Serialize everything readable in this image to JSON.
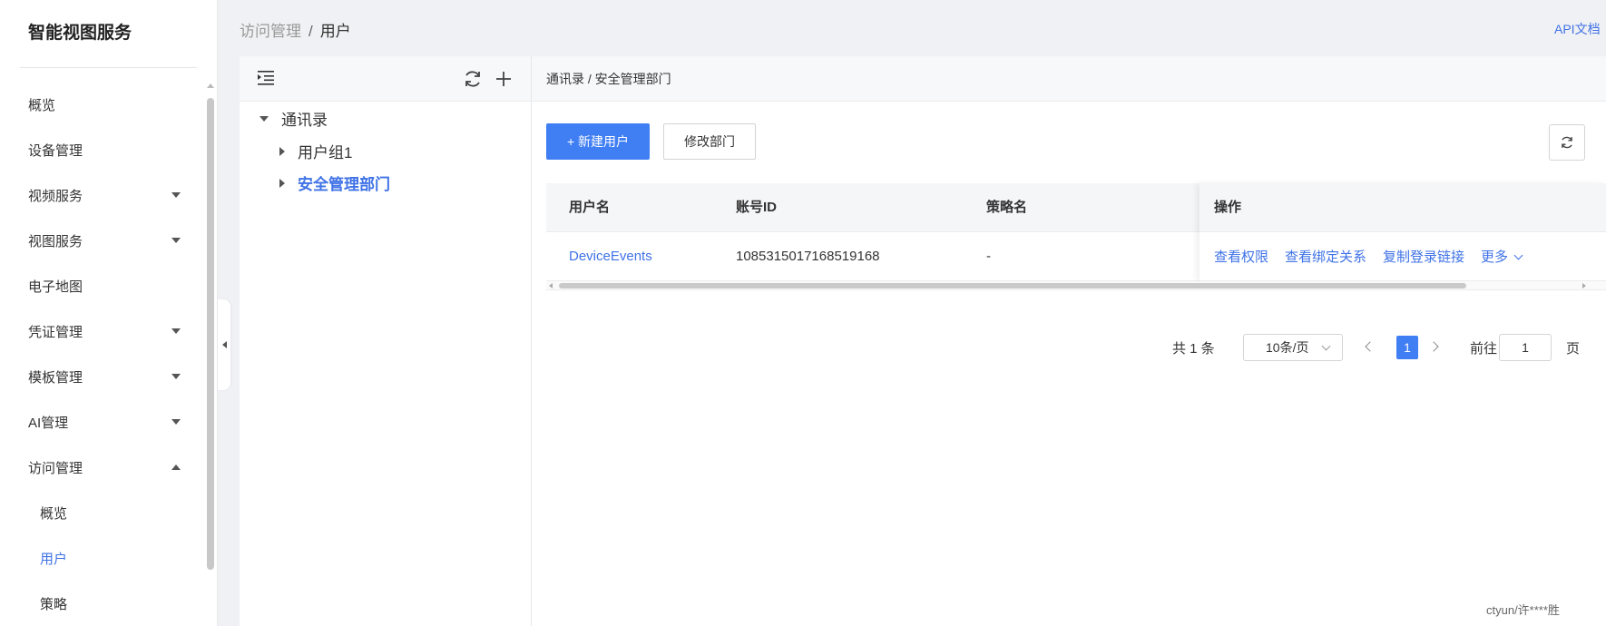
{
  "sidebar": {
    "brand": "智能视图服务",
    "items": [
      {
        "label": "概览",
        "name": "sidebar-item-overview"
      },
      {
        "label": "设备管理",
        "name": "sidebar-item-device-management"
      },
      {
        "label": "视频服务",
        "name": "sidebar-item-video-service"
      },
      {
        "label": "视图服务",
        "name": "sidebar-item-view-service"
      },
      {
        "label": "电子地图",
        "name": "sidebar-item-e-map"
      },
      {
        "label": "凭证管理",
        "name": "sidebar-item-credential-management"
      },
      {
        "label": "模板管理",
        "name": "sidebar-item-template-management"
      },
      {
        "label": "AI管理",
        "name": "sidebar-item-ai-management"
      },
      {
        "label": "访问管理",
        "name": "sidebar-item-access-management"
      },
      {
        "label": "概览",
        "name": "sidebar-subitem-access-overview"
      },
      {
        "label": "用户",
        "name": "sidebar-subitem-users"
      },
      {
        "label": "策略",
        "name": "sidebar-subitem-policies"
      }
    ]
  },
  "header": {
    "breadcrumb_parent": "访问管理",
    "breadcrumb_sep": "/",
    "breadcrumb_current": "用户",
    "api_doc": "API文档"
  },
  "tree": {
    "root": "通讯录",
    "children": [
      "用户组1",
      "安全管理部门"
    ]
  },
  "main": {
    "path": "通讯录 / 安全管理部门",
    "new_user_button": "+ 新建用户",
    "edit_dept_button": "修改部门",
    "table": {
      "columns": [
        "用户名",
        "账号ID",
        "策略名",
        "操作"
      ],
      "rows": [
        {
          "username": "DeviceEvents",
          "account_id": "1085315017168519168",
          "policy": "-"
        }
      ],
      "ops": [
        "查看权限",
        "查看绑定关系",
        "复制登录链接",
        "更多"
      ]
    },
    "pagination": {
      "total": "共 1 条",
      "page_size": "10条/页",
      "current_page": "1",
      "goto_label": "前往",
      "goto_value": "1",
      "page_suffix": "页"
    }
  },
  "watermark": "ctyun/许****胜",
  "colors": {
    "accent": "#3f7ef3",
    "link": "#3f72e6"
  }
}
